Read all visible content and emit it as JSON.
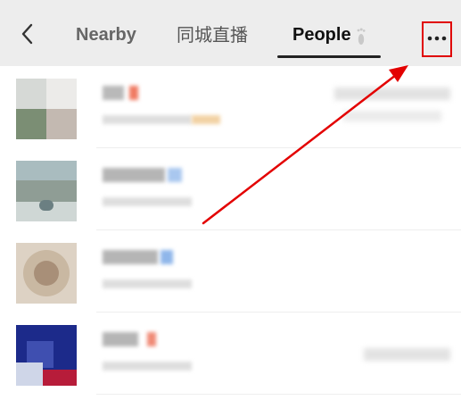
{
  "header": {
    "back_icon": "chevron-left-icon",
    "tabs": [
      {
        "label": "Nearby",
        "selected": false
      },
      {
        "label": "同城直播",
        "selected": false
      },
      {
        "label": "People",
        "selected": true
      }
    ],
    "people_tab_icon": "footprint-icon",
    "more_icon": "more-horizontal-icon",
    "highlight_color": "#e00000"
  },
  "list": {
    "items": [
      {
        "avatar_colors": [
          "#d6d9d6",
          "#7b8e74",
          "#c3b9b1",
          "#ecebe9"
        ],
        "name_accent": "#f07b63",
        "sub_accent": "#f2d2a4",
        "has_right_info": true
      },
      {
        "avatar_colors": [
          "#a9bcbf",
          "#6b7f82",
          "#8f9d95",
          "#cfd7d5"
        ],
        "name_accent": "#a9c7ef",
        "sub_accent": "",
        "has_right_info": false
      },
      {
        "avatar_colors": [
          "#c9b8a2",
          "#a88f78",
          "#b49c8c",
          "#ddd2c4"
        ],
        "name_accent": "#8fb6ea",
        "sub_accent": "",
        "has_right_info": false
      },
      {
        "avatar_colors": [
          "#1c2a8a",
          "#b71c3a",
          "#cfd6e8",
          "#3f4fb0"
        ],
        "name_accent": "#f08a76",
        "sub_accent": "",
        "has_right_info": true
      }
    ]
  },
  "annotation": {
    "arrow_color": "#e30000"
  }
}
